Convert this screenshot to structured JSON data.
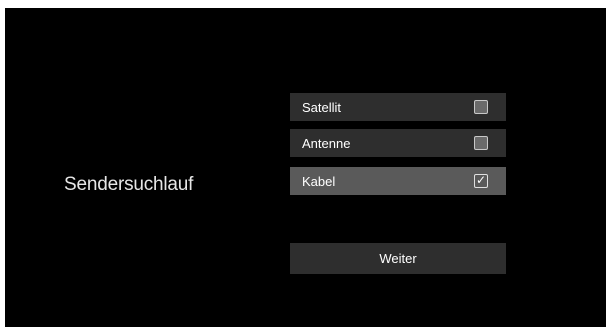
{
  "screen": {
    "title": "Sendersuchlauf"
  },
  "options": [
    {
      "label": "Satellit",
      "checked": false
    },
    {
      "label": "Antenne",
      "checked": false
    },
    {
      "label": "Kabel",
      "checked": true
    }
  ],
  "next_button": {
    "label": "Weiter"
  },
  "colors": {
    "background": "#000000",
    "row_normal": "#2e2e2e",
    "row_selected": "#5a5a5a",
    "text": "#ffffff"
  },
  "icons": {
    "unchecked": "checkbox-empty-icon",
    "checked": "checkbox-checked-icon"
  }
}
